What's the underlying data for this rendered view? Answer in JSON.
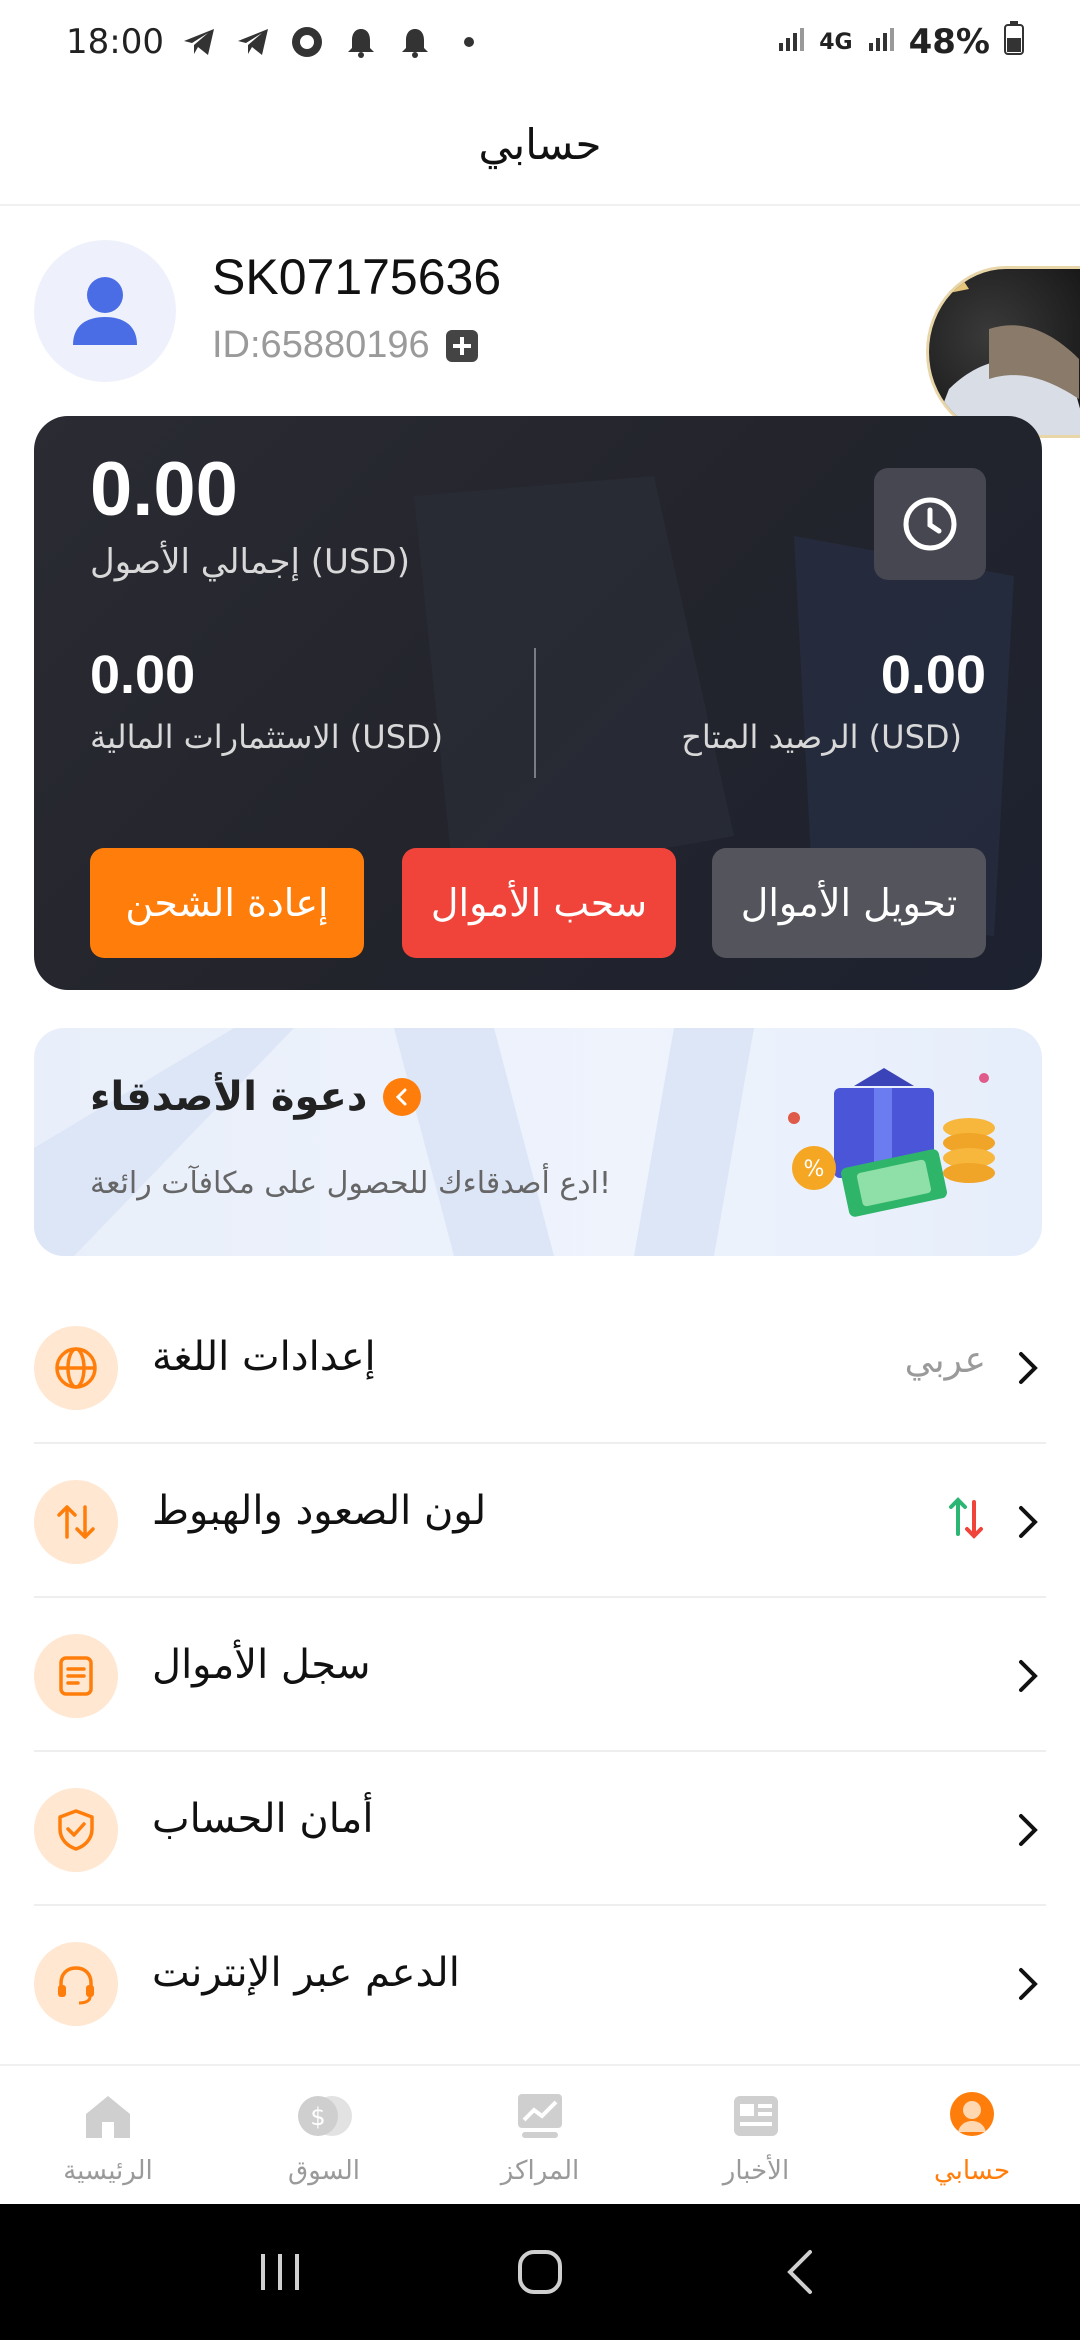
{
  "status_bar": {
    "time": "18:00",
    "battery": "48%",
    "network": "4G"
  },
  "header": {
    "title": "حسابي"
  },
  "profile": {
    "username": "SK07175636",
    "id_text": "ID:65880196"
  },
  "balance_card": {
    "total_value": "0.00",
    "total_label": "إجمالي الأصول  (USD)",
    "investments_value": "0.00",
    "investments_label": "الاستثمارات المالية  (USD)",
    "available_value": "0.00",
    "available_label": "الرصيد المتاح  (USD)",
    "buttons": {
      "recharge": "إعادة الشحن",
      "withdraw": "سحب الأموال",
      "transfer": "تحويل الأموال"
    }
  },
  "invite": {
    "title": "دعوة الأصدقاء",
    "subtitle": "ادع أصدقاءك للحصول على مكافآت رائعة!"
  },
  "menu": {
    "language": {
      "label": "إعدادات اللغة",
      "value": "عربي"
    },
    "updown_color": {
      "label": "لون الصعود والهبوط"
    },
    "fund_record": {
      "label": "سجل الأموال"
    },
    "security": {
      "label": "أمان الحساب"
    },
    "support": {
      "label": "الدعم عبر الإنترنت"
    }
  },
  "bottom_nav": {
    "home": "الرئيسية",
    "market": "السوق",
    "positions": "المراكز",
    "news": "الأخبار",
    "account": "حسابي"
  },
  "colors": {
    "accent": "#ff7d0a",
    "withdraw": "#f0443a",
    "transfer": "#54555c",
    "card_bg": "#23242c",
    "up": "#2bb673",
    "down": "#f0443a"
  }
}
